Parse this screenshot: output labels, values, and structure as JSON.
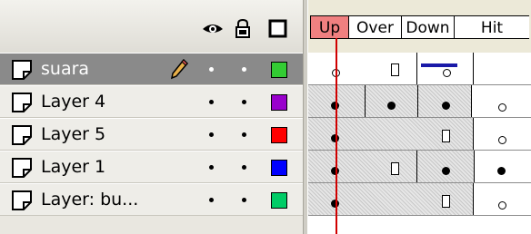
{
  "header": {
    "icons": [
      "eye-icon",
      "lock-icon",
      "outline-icon"
    ]
  },
  "frames": {
    "labels": [
      "Up",
      "Over",
      "Down",
      "Hit"
    ]
  },
  "layers": [
    {
      "name": "suara",
      "selected": true,
      "outline_color": "#33cc33"
    },
    {
      "name": "Layer 4",
      "selected": false,
      "outline_color": "#9900cc"
    },
    {
      "name": "Layer 5",
      "selected": false,
      "outline_color": "#ff0000"
    },
    {
      "name": "Layer 1",
      "selected": false,
      "outline_color": "#0000ff"
    },
    {
      "name": "Layer: bu...",
      "selected": false,
      "outline_color": "#00cc66"
    }
  ],
  "colors": {
    "playhead": "#d00000",
    "current_frame_highlight": "#f08080",
    "selected_row": "#8a8a8a"
  }
}
